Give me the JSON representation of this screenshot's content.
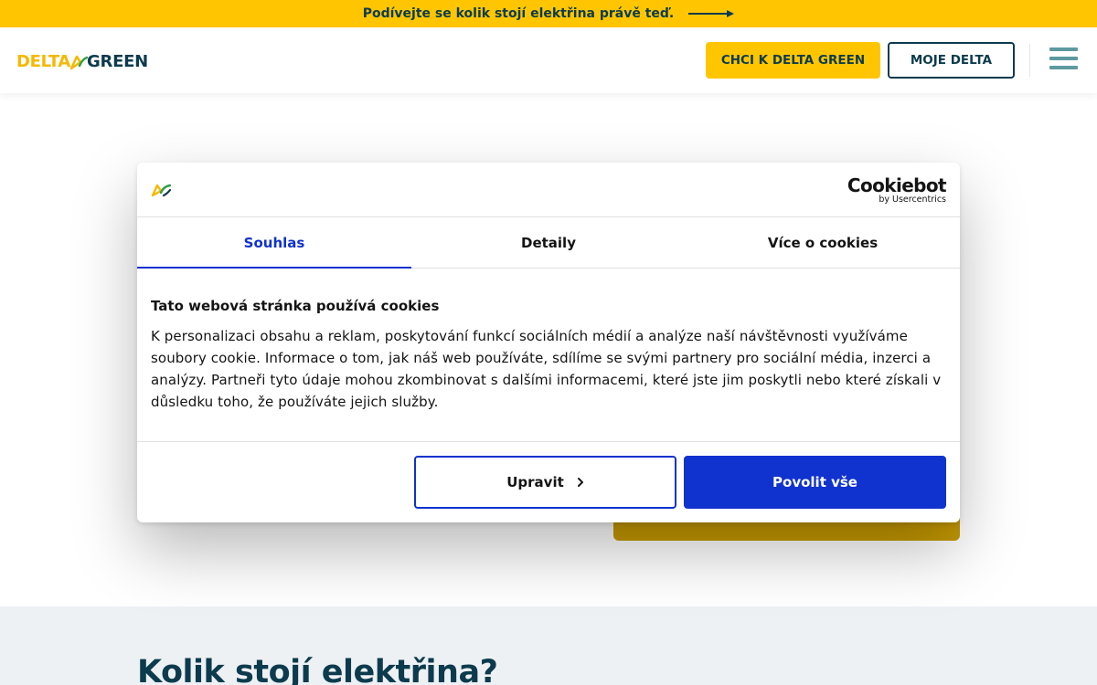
{
  "announcement": {
    "text": "Podívejte se kolik stojí elektřina právě teď.",
    "icon": "arrow-right-icon"
  },
  "header": {
    "logo_part1": "DELTA",
    "logo_part2": "GREEN",
    "primary_button": "CHCI K DELTA GREEN",
    "secondary_button": "MOJE DELTA",
    "menu_icon": "hamburger-menu-icon"
  },
  "cookie_dialog": {
    "provider_name": "Cookiebot",
    "provider_by": "by Usercentrics",
    "tabs": [
      {
        "label": "Souhlas",
        "active": true
      },
      {
        "label": "Detaily",
        "active": false
      },
      {
        "label": "Více o cookies",
        "active": false
      }
    ],
    "title": "Tato webová stránka používá cookies",
    "text": "K personalizaci obsahu a reklam, poskytování funkcí sociálních médií a analýze naší návštěvnosti využíváme soubory cookie. Informace o tom, jak náš web používáte, sdílíme se svými partnery pro sociální média, inzerci a analýzy. Partneři tyto údaje mohou zkombinovat s dalšími informacemi, které jste jim poskytli nebo které získali v důsledku toho, že používáte jejich služby.",
    "customize_button": "Upravit",
    "allow_all_button": "Povolit vše"
  },
  "section": {
    "heading": "Kolik stojí elektřina?"
  },
  "colors": {
    "brand_yellow": "#ffc600",
    "brand_navy": "#0c3b4d",
    "cookie_blue": "#1032cf",
    "section_bg": "#eef1f4"
  }
}
